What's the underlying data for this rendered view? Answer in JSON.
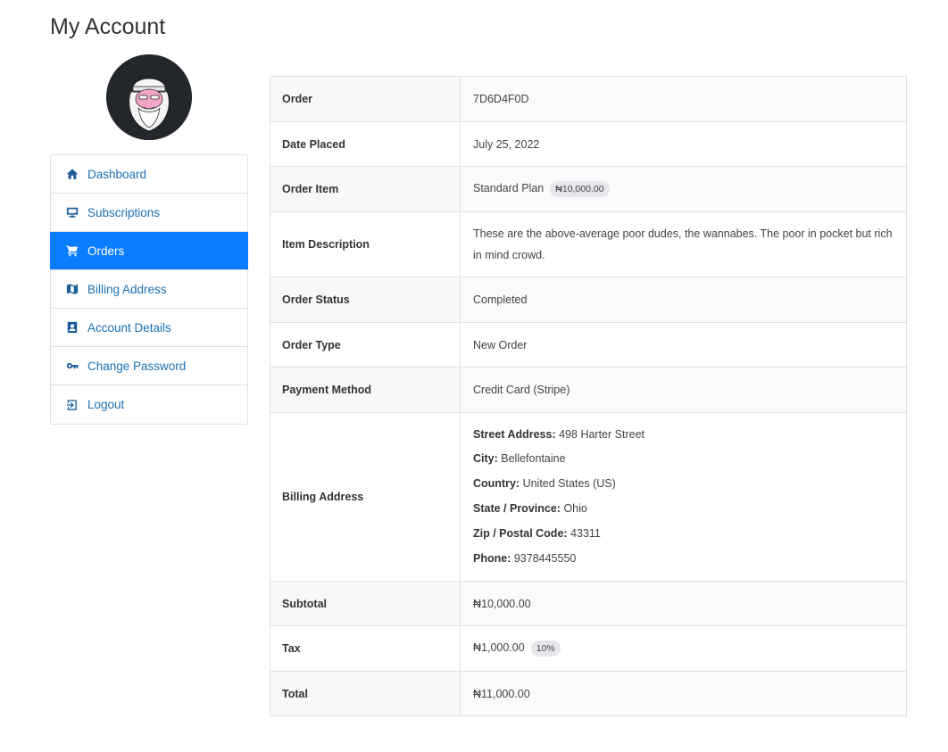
{
  "page": {
    "title": "My Account"
  },
  "nav": [
    {
      "label": "Dashboard",
      "icon": "home-icon",
      "active": false
    },
    {
      "label": "Subscriptions",
      "icon": "monitor-icon",
      "active": false
    },
    {
      "label": "Orders",
      "icon": "cart-icon",
      "active": true
    },
    {
      "label": "Billing Address",
      "icon": "map-icon",
      "active": false
    },
    {
      "label": "Account Details",
      "icon": "contact-card-icon",
      "active": false
    },
    {
      "label": "Change Password",
      "icon": "key-icon",
      "active": false
    },
    {
      "label": "Logout",
      "icon": "logout-icon",
      "active": false
    }
  ],
  "order": {
    "order_label": "Order",
    "order_value": "7D6D4F0D",
    "date_label": "Date Placed",
    "date_value": "July 25, 2022",
    "item_label": "Order Item",
    "item_value": "Standard Plan",
    "item_price": "₦10,000.00",
    "desc_label": "Item Description",
    "desc_value": "These are the above-average poor dudes, the wannabes. The poor in pocket but rich in mind crowd.",
    "status_label": "Order Status",
    "status_value": "Completed",
    "type_label": "Order Type",
    "type_value": "New Order",
    "payment_label": "Payment Method",
    "payment_value": "Credit Card (Stripe)",
    "billing_label": "Billing Address",
    "billing": {
      "street_label": "Street Address:",
      "street_value": "498 Harter Street",
      "city_label": "City:",
      "city_value": "Bellefontaine",
      "country_label": "Country:",
      "country_value": "United States (US)",
      "state_label": "State / Province:",
      "state_value": "Ohio",
      "zip_label": "Zip / Postal Code:",
      "zip_value": "43311",
      "phone_label": "Phone:",
      "phone_value": "9378445550"
    },
    "subtotal_label": "Subtotal",
    "subtotal_value": "₦10,000.00",
    "tax_label": "Tax",
    "tax_value": "₦1,000.00",
    "tax_rate": "10%",
    "total_label": "Total",
    "total_value": "₦11,000.00"
  },
  "colors": {
    "accent": "#0a7cff",
    "link": "#1a6fb5",
    "border": "#dee2e6"
  }
}
